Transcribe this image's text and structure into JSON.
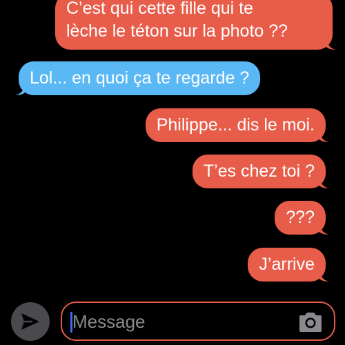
{
  "conversation": {
    "messages": [
      {
        "sender": "me",
        "text_line1": "C’est qui cette fille qui te",
        "text_line2": "lèche le téton sur la photo ??"
      },
      {
        "sender": "other",
        "text": "Lol... en quoi ça te regarde ?"
      },
      {
        "sender": "me",
        "text": "Philippe... dis le moi."
      },
      {
        "sender": "me",
        "text": "T’es chez toi ?"
      },
      {
        "sender": "me",
        "text": "???"
      },
      {
        "sender": "me",
        "text": "J’arrive"
      }
    ]
  },
  "composer": {
    "placeholder": "Message",
    "send_icon": "send-arrow-icon",
    "camera_icon": "camera-icon"
  },
  "colors": {
    "background": "#000000",
    "sent_bubble": "#e85c4a",
    "received_bubble": "#5ab8f5",
    "send_button": "#4a4a4e",
    "cursor": "#3b6ef5",
    "placeholder": "#8a8a8e"
  }
}
